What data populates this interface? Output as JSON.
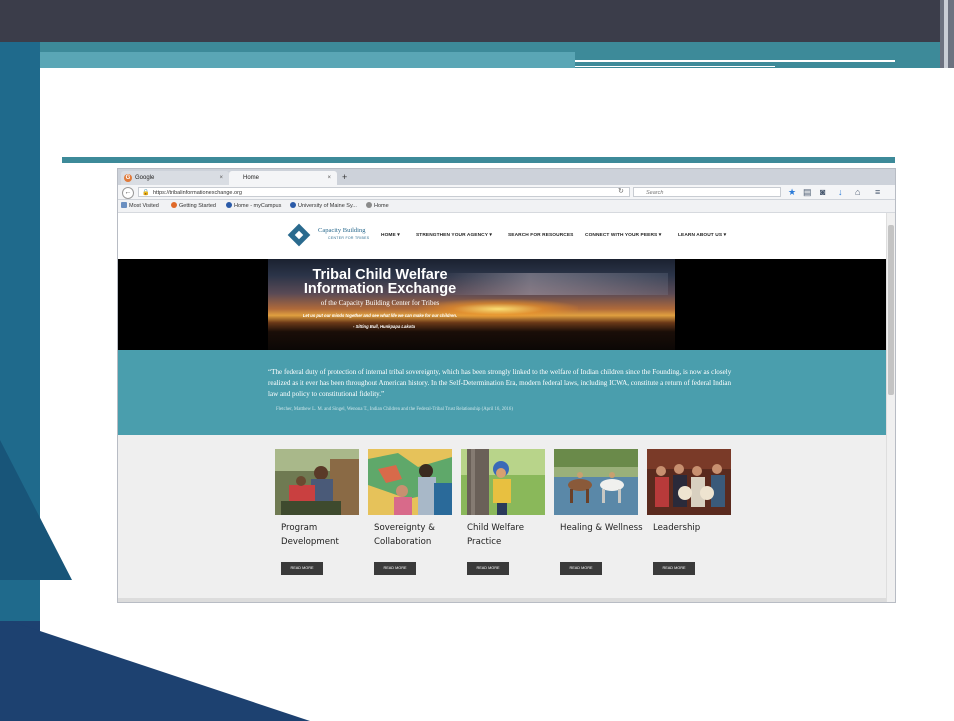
{
  "browser": {
    "tabs": [
      {
        "label": "Google",
        "close": "×"
      },
      {
        "label": "Home",
        "close": "×"
      }
    ],
    "new_tab": "+",
    "url": "https://tribalinformationexchange.org",
    "search_placeholder": "Search",
    "bookmarks": [
      {
        "label": "Most Visited"
      },
      {
        "label": "Getting Started"
      },
      {
        "label": "Home - myCampus"
      },
      {
        "label": "University of Maine Sy..."
      },
      {
        "label": "Home"
      }
    ],
    "icons": [
      "back-icon",
      "lock-icon",
      "reload-icon",
      "search-icon",
      "star-icon",
      "reading-list-icon",
      "pocket-icon",
      "download-icon",
      "home-icon",
      "menu-icon"
    ]
  },
  "site": {
    "logo": {
      "name": "Capacity Building",
      "sub": "CENTER FOR TRIBES"
    },
    "menu": [
      "HOME",
      "STRENGTHEN YOUR AGENCY",
      "SEARCH FOR RESOURCES",
      "CONNECT WITH YOUR PEERS",
      "LEARN ABOUT US"
    ],
    "hero": {
      "title_line1": "Tribal Child Welfare",
      "title_line2": "Information Exchange",
      "subtitle": "of the Capacity Building Center for Tribes",
      "quote": "Let us put our minds together and see what life we can make for our children.",
      "attribution": "- Sitting Bull, Hunkpapa Lakota"
    },
    "quote_band": {
      "text": "“The federal duty of protection of internal tribal sovereignty, which has been strongly linked to the welfare of Indian children since the Founding, is now as closely realized as it ever has been throughout American history. In the Self-Determination Era, modern federal laws, including ICWA, constitute a return of federal Indian law and policy to constitutional fidelity.”",
      "citation": "Fletcher, Matthew L. M. and Singel, Wenona T., Indian Children and the Federal-Tribal Trust Relationship (April 16, 2016)"
    },
    "cards": [
      {
        "title": "Program Development",
        "button": "READ MORE"
      },
      {
        "title": "Sovereignty & Collaboration",
        "button": "READ MORE"
      },
      {
        "title": "Child Welfare Practice",
        "button": "READ MORE"
      },
      {
        "title": "Healing & Wellness",
        "button": "READ MORE"
      },
      {
        "title": "Leadership",
        "button": "READ MORE"
      }
    ]
  },
  "colors": {
    "slide_dark": "#3b3d4a",
    "slide_teal": "#3d8a99",
    "slide_navy": "#1d4170",
    "site_teal": "#4a9ead",
    "brand_blue": "#2a6a8e"
  }
}
